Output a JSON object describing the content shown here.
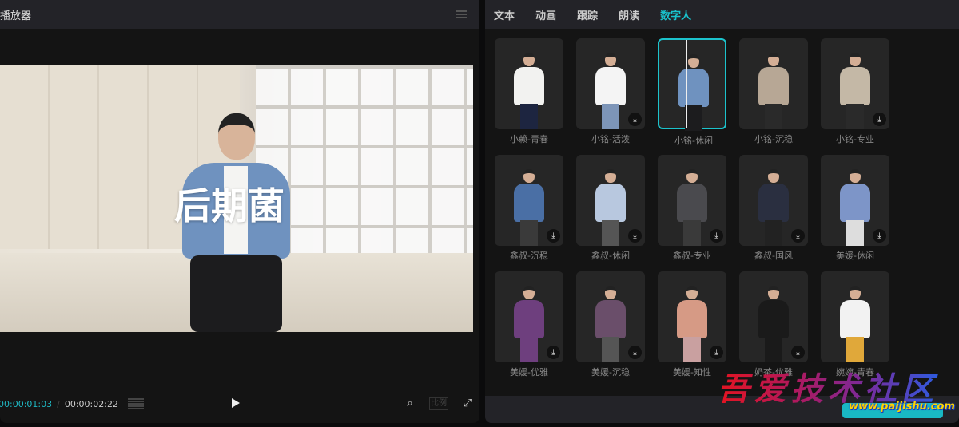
{
  "player": {
    "title": "播放器",
    "overlay_text": "后期菌",
    "current_time": "00:00:01:03",
    "separator": "/",
    "total_time": "00:00:02:22",
    "ratio_label": "比例"
  },
  "panel": {
    "tabs": [
      {
        "label": "文本"
      },
      {
        "label": "动画"
      },
      {
        "label": "跟踪"
      },
      {
        "label": "朗读"
      },
      {
        "label": "数字人",
        "active": true
      }
    ],
    "accent": "#1cc3cc"
  },
  "avatars": [
    {
      "label": "小赖-青春",
      "top": "#f2f2f0",
      "bottom": "#1d2540",
      "download": false
    },
    {
      "label": "小铭-活泼",
      "top": "#f4f4f4",
      "bottom": "#7d95b8",
      "download": true
    },
    {
      "label": "小铭-休闲",
      "top": "#6f92bf",
      "bottom": "#1c1c1e",
      "download": false,
      "selected": true
    },
    {
      "label": "小铭-沉稳",
      "top": "#b7a795",
      "bottom": "#2a2a2a",
      "download": false
    },
    {
      "label": "小铭-专业",
      "top": "#c4b8a6",
      "bottom": "#2a2a2a",
      "download": true
    },
    {
      "label": "鑫叔-沉稳",
      "top": "#4a6fa5",
      "bottom": "#3a3a3a",
      "download": true
    },
    {
      "label": "鑫叔-休闲",
      "top": "#b8c8df",
      "bottom": "#555",
      "download": true
    },
    {
      "label": "鑫叔-专业",
      "top": "#4a4a4e",
      "bottom": "#3a3a3a",
      "download": true
    },
    {
      "label": "鑫叔-国风",
      "top": "#2a2f40",
      "bottom": "#222",
      "download": true
    },
    {
      "label": "美媛-休闲",
      "top": "#7d95c8",
      "bottom": "#ddd",
      "download": true
    },
    {
      "label": "美媛-优雅",
      "top": "#6e3f7e",
      "bottom": "#6e3f7e",
      "download": true
    },
    {
      "label": "美媛-沉稳",
      "top": "#6a4e6a",
      "bottom": "#555",
      "download": true
    },
    {
      "label": "美媛-知性",
      "top": "#d69a85",
      "bottom": "#c9a0a0",
      "download": true
    },
    {
      "label": "奶茶-优雅",
      "top": "#1a1a1a",
      "bottom": "#1a1a1a",
      "download": true
    },
    {
      "label": "婉婉-青春",
      "top": "#f2f2f2",
      "bottom": "#e0a83a",
      "download": false
    }
  ],
  "watermark": {
    "logo_text": "吾爱技术社区",
    "url": "www.paijishu.com"
  }
}
